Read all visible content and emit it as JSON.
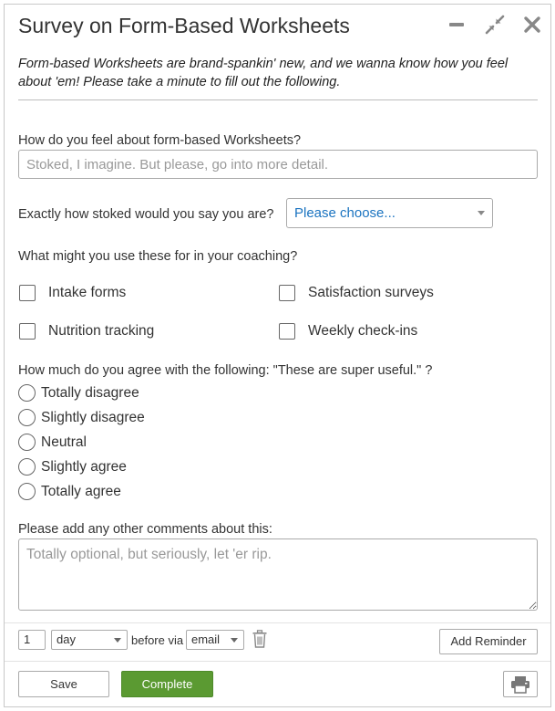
{
  "dialog": {
    "title": "Survey on Form-Based Worksheets",
    "intro": "Form-based Worksheets are brand-spankin' new, and we wanna know how you feel about 'em! Please take a minute to fill out the following.",
    "icons": [
      "minimize-icon",
      "collapse-icon",
      "close-icon"
    ]
  },
  "q1": {
    "label": "How do you feel about form-based Worksheets?",
    "placeholder": "Stoked, I imagine. But please, go into more detail.",
    "value": ""
  },
  "q2": {
    "label": "Exactly how stoked would you say you are?",
    "selected": "Please choose..."
  },
  "q3": {
    "label": "What might you use these for in your coaching?",
    "options": [
      "Intake forms",
      "Satisfaction surveys",
      "Nutrition tracking",
      "Weekly check-ins"
    ]
  },
  "q4": {
    "label": "How much do you agree with the following: \"These are super useful.\" ?",
    "options": [
      "Totally disagree",
      "Slightly disagree",
      "Neutral",
      "Slightly agree",
      "Totally agree"
    ]
  },
  "q5": {
    "label": "Please add any other comments about this:",
    "placeholder": "Totally optional, but seriously, let 'er rip.",
    "value": ""
  },
  "reminder": {
    "amount": "1",
    "unit": "day",
    "before_via": "before via",
    "channel": "email",
    "add_label": "Add Reminder"
  },
  "footer": {
    "save_label": "Save",
    "complete_label": "Complete"
  },
  "colors": {
    "accent_green": "#5b9a32",
    "select_link_blue": "#1a73c0",
    "border": "#c8c8c8"
  }
}
